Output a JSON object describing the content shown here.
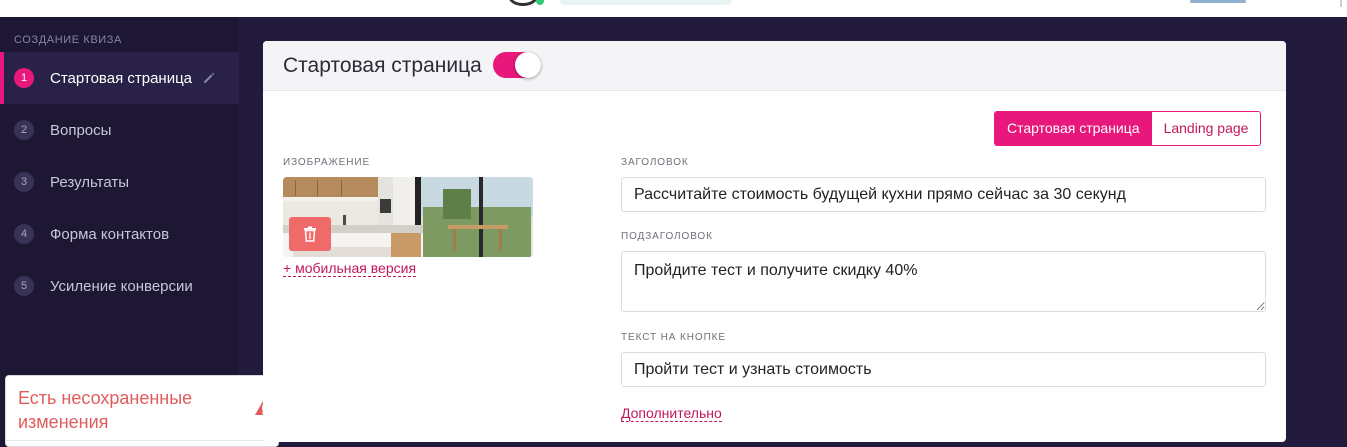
{
  "sidebar": {
    "heading": "СОЗДАНИЕ КВИЗА",
    "items": [
      {
        "num": "1",
        "label": "Стартовая страница"
      },
      {
        "num": "2",
        "label": "Вопросы"
      },
      {
        "num": "3",
        "label": "Результаты"
      },
      {
        "num": "4",
        "label": "Форма контактов"
      },
      {
        "num": "5",
        "label": "Усиление конверсии"
      }
    ]
  },
  "toast": {
    "text": "Есть несохраненные изменения",
    "icon": "warning-triangle-icon"
  },
  "card": {
    "title": "Стартовая страница",
    "toggle_on": true,
    "tabs": {
      "start": "Стартовая страница",
      "landing": "Landing page"
    },
    "image_label": "ИЗОБРАЖЕНИЕ",
    "mobile_link": "+ мобильная версия",
    "heading_label": "ЗАГОЛОВОК",
    "heading_value": "Рассчитайте стоимость будущей кухни прямо сейчас за 30 секунд",
    "subheading_label": "ПОДЗАГОЛОВОК",
    "subheading_value": "Пройдите тест и получите скидку 40%",
    "button_label": "ТЕКСТ НА КНОПКЕ",
    "button_value": "Пройти тест и узнать стоимость",
    "more_link": "Дополнительно"
  },
  "colors": {
    "accent": "#e8177c",
    "sidebar_bg": "#1d1733",
    "warning": "#e05c5c"
  }
}
